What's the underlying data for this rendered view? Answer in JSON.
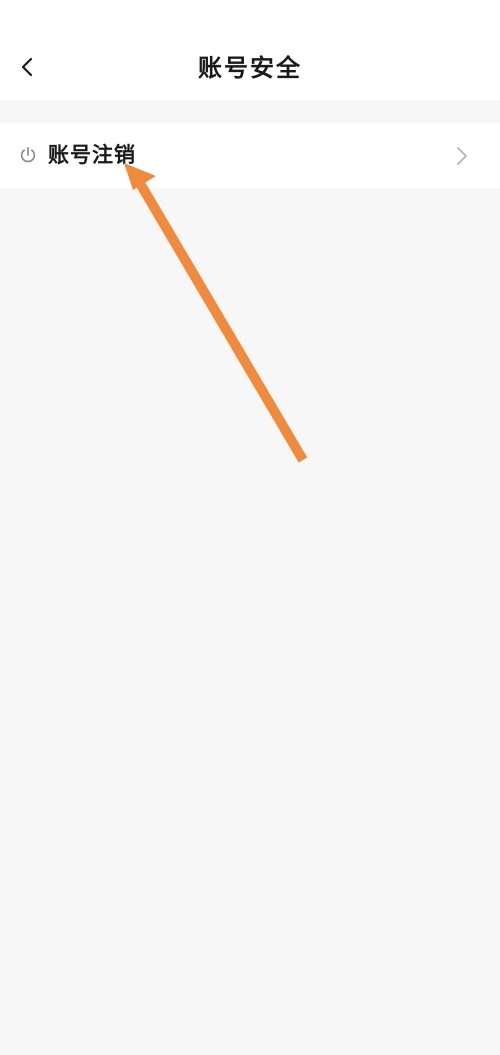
{
  "header": {
    "title": "账号安全",
    "back_icon": "chevron-left-icon"
  },
  "list": {
    "items": [
      {
        "label": "账号注销",
        "icon": "power-icon",
        "trailing_icon": "chevron-right-icon"
      }
    ]
  },
  "colors": {
    "page_background": "#f7f7f7",
    "surface": "#ffffff",
    "text_primary": "#1a1a1a",
    "icon_muted": "#888888",
    "chevron": "#bbbbbb",
    "annotation_arrow": "#f08a3c"
  }
}
